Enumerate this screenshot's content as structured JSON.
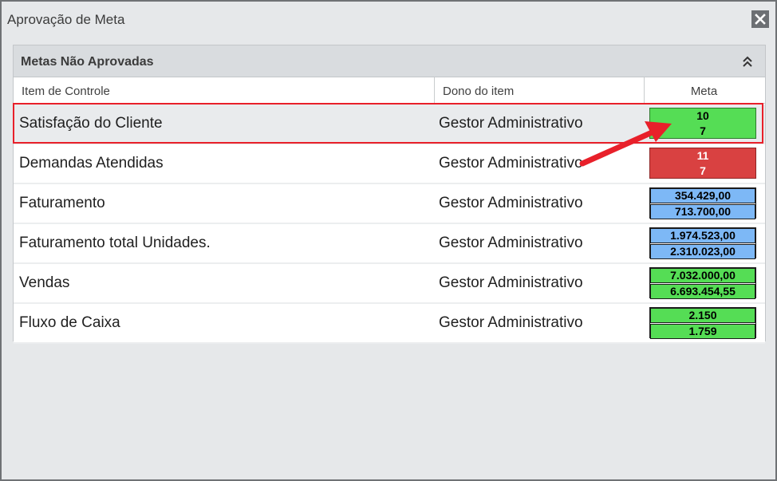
{
  "window": {
    "title": "Aprovação de Meta",
    "close_icon": "close-icon"
  },
  "panel": {
    "title": "Metas Não Aprovadas",
    "collapse_icon": "double-chevron-up-icon"
  },
  "columns": {
    "item": "Item de Controle",
    "owner": "Dono do item",
    "meta": "Meta"
  },
  "rows": [
    {
      "item": "Satisfação do Cliente",
      "owner": "Gestor Administrativo",
      "meta_top": "10",
      "meta_bottom": "7",
      "status": "green",
      "selected": true
    },
    {
      "item": "Demandas Atendidas",
      "owner": "Gestor Administrativo",
      "meta_top": "11",
      "meta_bottom": "7",
      "status": "red",
      "selected": false
    },
    {
      "item": "Faturamento",
      "owner": "Gestor Administrativo",
      "meta_top": "354.429,00",
      "meta_bottom": "713.700,00",
      "status": "blue",
      "selected": false
    },
    {
      "item": "Faturamento total Unidades.",
      "owner": "Gestor Administrativo",
      "meta_top": "1.974.523,00",
      "meta_bottom": "2.310.023,00",
      "status": "blue",
      "selected": false
    },
    {
      "item": "Vendas",
      "owner": "Gestor Administrativo",
      "meta_top": "7.032.000,00",
      "meta_bottom": "6.693.454,55",
      "status": "green",
      "selected": false
    },
    {
      "item": "Fluxo de Caixa",
      "owner": "Gestor Administrativo",
      "meta_top": "2.150",
      "meta_bottom": "1.759",
      "status": "green",
      "selected": false
    }
  ],
  "colors": {
    "green": "#55dd55",
    "red": "#d94141",
    "blue": "#7db8f6",
    "highlight": "#e8202a"
  }
}
